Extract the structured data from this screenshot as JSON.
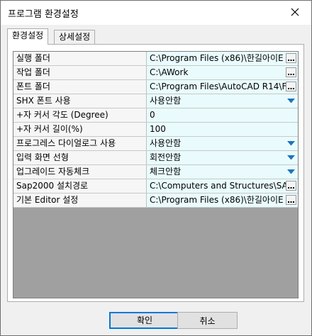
{
  "window": {
    "title": "프로그램 환경설정"
  },
  "tabs": [
    {
      "label": "환경설정",
      "active": true
    },
    {
      "label": "상세설정",
      "active": false
    }
  ],
  "rows": [
    {
      "name": "실행 폴더",
      "value": "C:\\Program Files (x86)\\한길아이E",
      "control": "ellipsis"
    },
    {
      "name": "작업 폴더",
      "value": "C:\\AWork",
      "control": "ellipsis"
    },
    {
      "name": "폰트 폴더",
      "value": "C:\\Program Files\\AutoCAD R14\\F",
      "control": "ellipsis"
    },
    {
      "name": "SHX 폰트 사용",
      "value": "사용안함",
      "control": "dropdown"
    },
    {
      "name": "+자 커서 각도 (Degree)",
      "value": "0",
      "control": "none"
    },
    {
      "name": "+자 커서 길이(%)",
      "value": "100",
      "control": "none"
    },
    {
      "name": "프로그레스 다이얼로그 사용",
      "value": "사용안함",
      "control": "dropdown"
    },
    {
      "name": "입력 화면 선형",
      "value": "회전안함",
      "control": "dropdown"
    },
    {
      "name": "업그레이드 자동체크",
      "value": "체크안함",
      "control": "dropdown"
    },
    {
      "name": "Sap2000 설치경로",
      "value": "C:\\Computers and Structures\\SAP",
      "control": "ellipsis"
    },
    {
      "name": "기본 Editor 설정",
      "value": "C:\\Program Files (x86)\\한길아이E",
      "control": "ellipsis"
    }
  ],
  "buttons": {
    "ok": "확인",
    "cancel": "취소"
  },
  "colors": {
    "value_bg": "#e9fbfd",
    "dropdown_arrow": "#1e73be",
    "default_button_border": "#0078d7"
  }
}
